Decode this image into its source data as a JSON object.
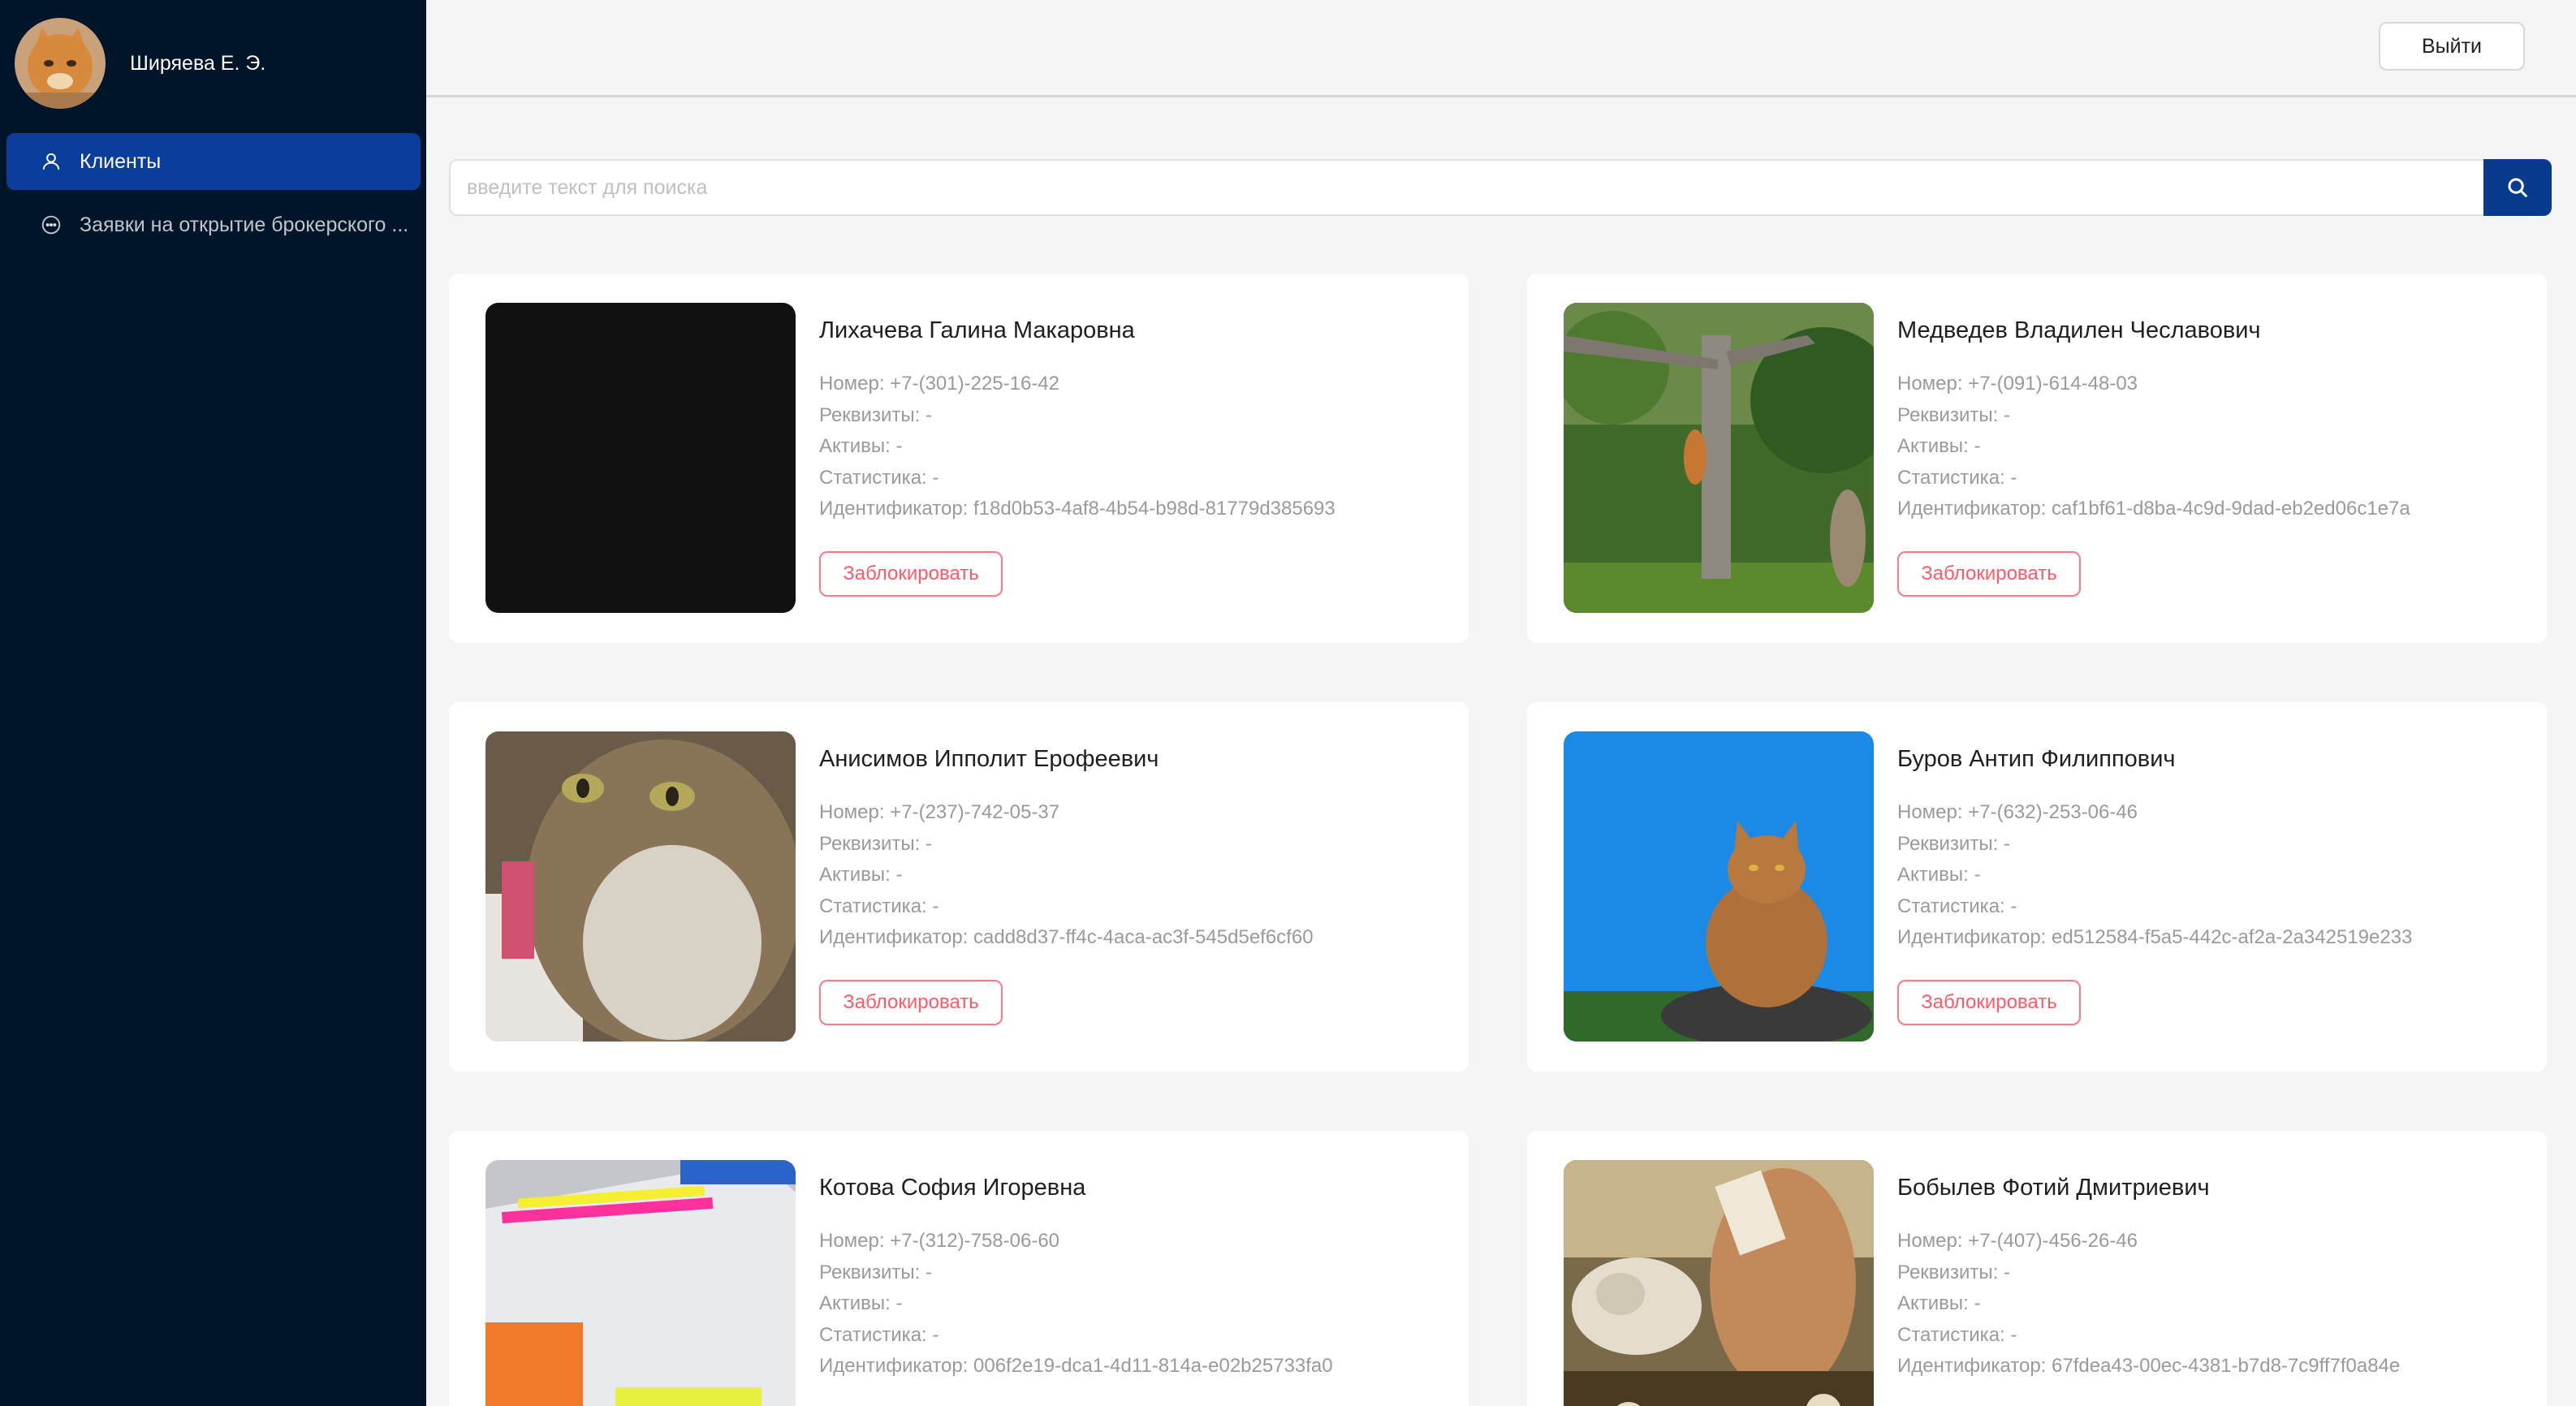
{
  "sidebar": {
    "user_name": "Ширяева Е. Э.",
    "menu": [
      {
        "label": "Клиенты",
        "icon": "user-icon",
        "active": true
      },
      {
        "label": "Заявки на открытие брокерского ...",
        "icon": "message-icon",
        "active": false
      }
    ]
  },
  "header": {
    "logout_label": "Выйти"
  },
  "search": {
    "placeholder": "введите текст для поиска",
    "button_icon": "search-icon"
  },
  "labels": {
    "phone": "Номер:",
    "requisites": "Реквизиты:",
    "assets": "Активы:",
    "stats": "Статистика:",
    "id": "Идентификатор:",
    "block": "Заблокировать"
  },
  "clients": [
    {
      "name": "Лихачева Галина Макаровна",
      "phone": "+7-(301)-225-16-42",
      "requisites": "-",
      "assets": "-",
      "stats": "-",
      "id": "f18d0b53-4af8-4b54-b98d-81779d385693",
      "photo": "black-square"
    },
    {
      "name": "Медведев Владилен Чеславович",
      "phone": "+7-(091)-614-48-03",
      "requisites": "-",
      "assets": "-",
      "stats": "-",
      "id": "caf1bf61-d8ba-4c9d-9dad-eb2ed06c1e7a",
      "photo": "cat-on-tree-photo"
    },
    {
      "name": "Анисимов Ипполит Ерофеевич",
      "phone": "+7-(237)-742-05-37",
      "requisites": "-",
      "assets": "-",
      "stats": "-",
      "id": "cadd8d37-ff4c-4aca-ac3f-545d5ef6cf60",
      "photo": "tabby-cat-closeup-photo"
    },
    {
      "name": "Буров Антип Филиппович",
      "phone": "+7-(632)-253-06-46",
      "requisites": "-",
      "assets": "-",
      "stats": "-",
      "id": "ed512584-f5a5-442c-af2a-2a342519e233",
      "photo": "cat-on-rock-sky-photo"
    },
    {
      "name": "Котова София Игоревна",
      "phone": "+7-(312)-758-06-60",
      "requisites": "-",
      "assets": "-",
      "stats": "-",
      "id": "006f2e19-dca1-4d11-814a-e02b25733fa0",
      "photo": "notebook-highlighters-photo"
    },
    {
      "name": "Бобылев Фотий Дмитриевич",
      "phone": "+7-(407)-456-26-46",
      "requisites": "-",
      "assets": "-",
      "stats": "-",
      "id": "67fdea43-00ec-4381-b7d8-7c9ff7f0a84e",
      "photo": "woman-with-cat-painting"
    }
  ]
}
